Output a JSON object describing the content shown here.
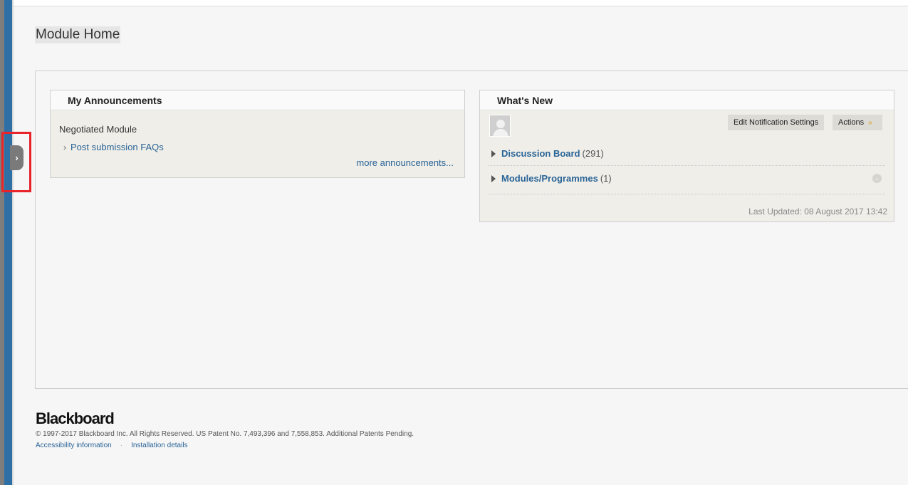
{
  "page": {
    "title": "Module Home"
  },
  "announcements": {
    "heading": "My Announcements",
    "course": "Negotiated Module",
    "items": [
      {
        "label": "Post submission FAQs"
      }
    ],
    "more_link": "more announcements..."
  },
  "whats_new": {
    "heading": "What's New",
    "edit_button": "Edit Notification Settings",
    "actions_button": "Actions",
    "rows": [
      {
        "label": "Discussion Board",
        "count": "(291)"
      },
      {
        "label": "Modules/Programmes",
        "count": "(1)"
      }
    ],
    "last_updated": "Last Updated: 08 August 2017 13:42"
  },
  "footer": {
    "logo": "Blackboard",
    "copyright": "© 1997-2017 Blackboard Inc. All Rights Reserved. US Patent No. 7,493,396 and 7,558,853. Additional Patents Pending.",
    "links": [
      "Accessibility information",
      "Installation details"
    ]
  },
  "colors": {
    "link": "#2a6496",
    "rail": "#2e6fa6",
    "highlight": "#e8232a"
  }
}
